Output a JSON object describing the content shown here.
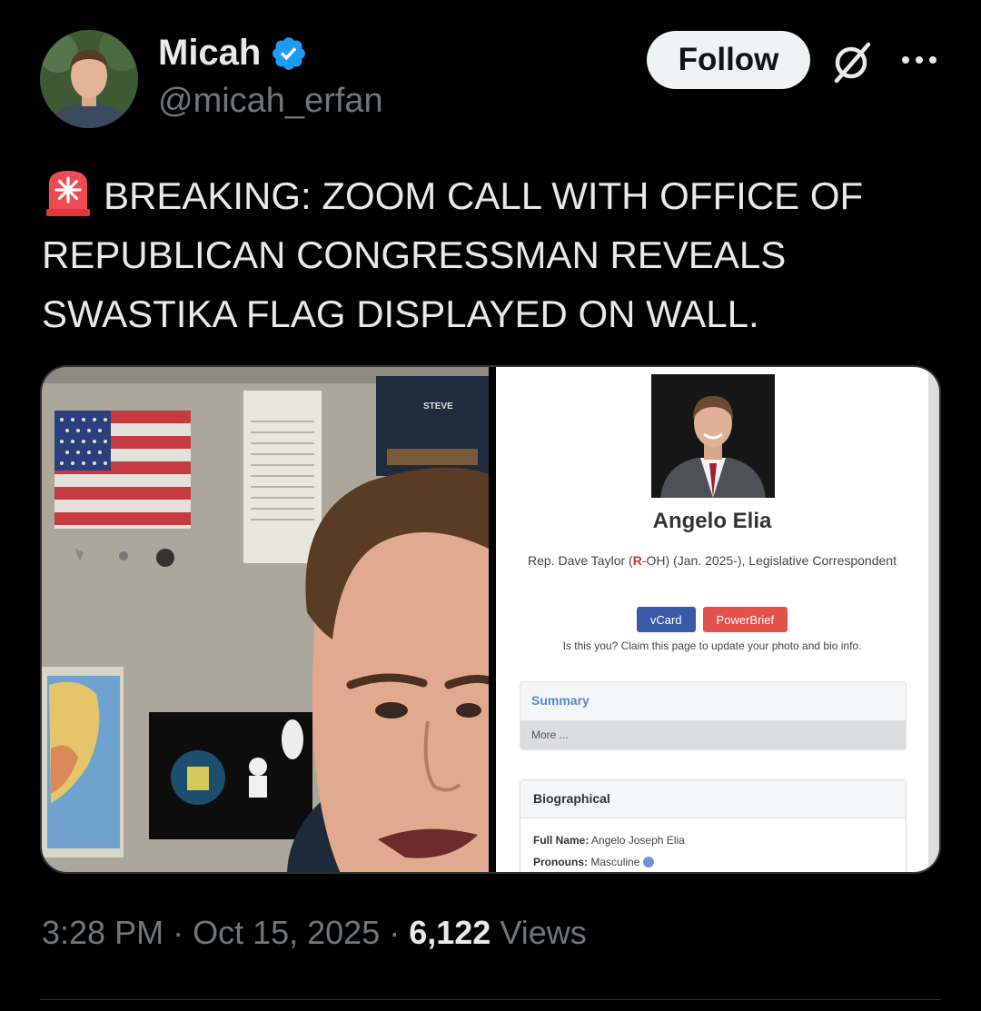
{
  "author": {
    "display_name": "Micah",
    "handle": "@micah_erfan",
    "verified": true
  },
  "header": {
    "follow_label": "Follow"
  },
  "tweet": {
    "icon": "police-light-siren-icon",
    "text": "BREAKING: ZOOM CALL WITH OFFICE OF REPUBLICAN CONGRESSMAN REVEALS SWASTIKA FLAG DISPLAYED ON WALL."
  },
  "media": {
    "left_image": "zoom-call-selfie-with-flag-photo",
    "profile_page": {
      "name": "Angelo Elia",
      "title_pre": "Rep. Dave Taylor (",
      "title_party": "R",
      "title_post": "-OH) (Jan. 2025-), Legislative Correspondent",
      "vcard_label": "vCard",
      "powerbrief_label": "PowerBrief",
      "claim_text": "Is this you? Claim this page to update your photo and bio info.",
      "summary_title": "Summary",
      "summary_more": "More ...",
      "bio_title": "Biographical",
      "full_name_label": "Full Name:",
      "full_name_value": "Angelo Joseph Elia",
      "pronouns_label": "Pronouns:",
      "pronouns_value": "Masculine"
    }
  },
  "footer": {
    "time": "3:28 PM",
    "separator": " · ",
    "date": "Oct 15, 2025",
    "views_count": "6,122",
    "views_label": "Views"
  },
  "colors": {
    "background": "#000000",
    "text": "#e7e9ea",
    "muted": "#71767b",
    "verified": "#1d9bf0",
    "follow_bg": "#eff3f4"
  }
}
